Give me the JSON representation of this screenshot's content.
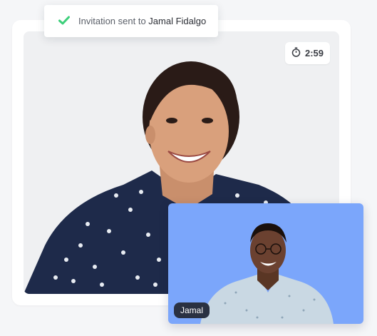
{
  "notification": {
    "prefix": "Invitation sent to",
    "recipient": "Jamal Fidalgo",
    "icon": "check-icon",
    "icon_color": "#3ccf7a"
  },
  "call": {
    "timer": "2:59",
    "timer_icon": "stopwatch-icon"
  },
  "participant_pip": {
    "name": "Jamal",
    "background_color": "#7ba6fb"
  }
}
